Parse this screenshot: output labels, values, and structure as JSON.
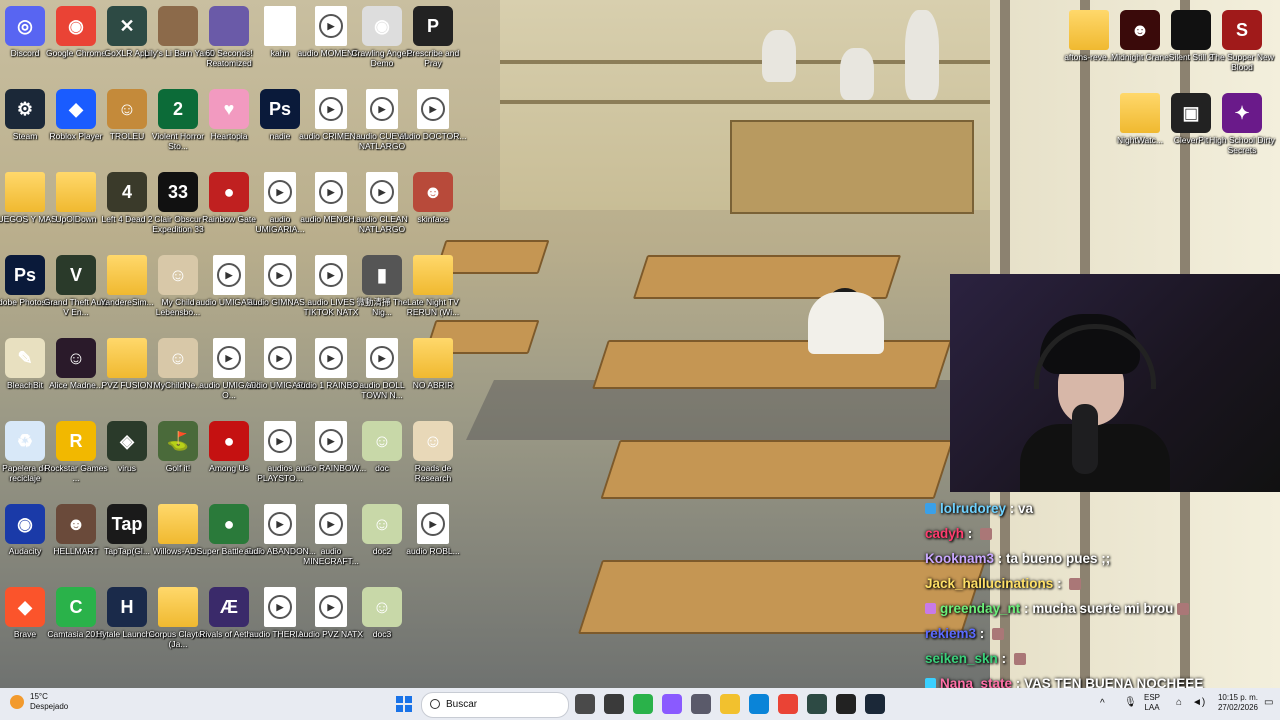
{
  "desktop_icons": [
    {
      "label": "Discord",
      "color": "#5865f2",
      "glyph": "◎",
      "x": 0,
      "y": 0
    },
    {
      "label": "Google Chrome",
      "color": "#ea4335",
      "glyph": "◉",
      "x": 1,
      "y": 0
    },
    {
      "label": "GoXLR App",
      "color": "#2d4a44",
      "glyph": "✕",
      "x": 2,
      "y": 0
    },
    {
      "label": "Lily's Li Barn Yard",
      "color": "#8c6a4a",
      "glyph": "",
      "x": 3,
      "y": 0
    },
    {
      "label": "60 Seconds! Reatomized",
      "color": "#6a5aa8",
      "glyph": "",
      "x": 4,
      "y": 0
    },
    {
      "label": "kahn",
      "color": "file",
      "glyph": "",
      "x": 5,
      "y": 0
    },
    {
      "label": "audio MOMENT...",
      "color": "audio",
      "glyph": "",
      "x": 6,
      "y": 0
    },
    {
      "label": "Crawling Angels Demo",
      "color": "#ddd",
      "glyph": "◉",
      "x": 7,
      "y": 0
    },
    {
      "label": "Prescribe and Pray",
      "color": "#222",
      "glyph": "P",
      "x": 8,
      "y": 0
    },
    {
      "label": "Steam",
      "color": "#1b2838",
      "glyph": "⚙",
      "x": 0,
      "y": 1
    },
    {
      "label": "Roblox Player",
      "color": "#1a5cff",
      "glyph": "◆",
      "x": 1,
      "y": 1
    },
    {
      "label": "TROLEU",
      "color": "#c48a3a",
      "glyph": "☺",
      "x": 2,
      "y": 1
    },
    {
      "label": "Violent Horror Sto...",
      "color": "#0c6b38",
      "glyph": "2",
      "x": 3,
      "y": 1
    },
    {
      "label": "Heartopia",
      "color": "#f29ac0",
      "glyph": "♥",
      "x": 4,
      "y": 1
    },
    {
      "label": "nadie",
      "color": "#0a1a3a",
      "glyph": "Ps",
      "x": 5,
      "y": 1
    },
    {
      "label": "audio CRIMEN...",
      "color": "audio",
      "glyph": "",
      "x": 6,
      "y": 1
    },
    {
      "label": "audio CUEVA NATLARGO",
      "color": "audio",
      "glyph": "",
      "x": 7,
      "y": 1
    },
    {
      "label": "audio DOCTOR...",
      "color": "audio",
      "glyph": "",
      "x": 8,
      "y": 1
    },
    {
      "label": "JUEGOS Y MAS",
      "color": "folder",
      "glyph": "",
      "x": 0,
      "y": 2
    },
    {
      "label": "UpOlDown",
      "color": "folder",
      "glyph": "",
      "x": 1,
      "y": 2
    },
    {
      "label": "Left 4 Dead 2",
      "color": "#3a3a2a",
      "glyph": "4",
      "x": 2,
      "y": 2
    },
    {
      "label": "Clair Obscur Expedition 33",
      "color": "#111",
      "glyph": "33",
      "x": 3,
      "y": 2
    },
    {
      "label": "Rainbow Gate",
      "color": "#c02020",
      "glyph": "●",
      "x": 4,
      "y": 2
    },
    {
      "label": "audio UMIGARIA...",
      "color": "audio",
      "glyph": "",
      "x": 5,
      "y": 2
    },
    {
      "label": "audio MENCH...",
      "color": "audio",
      "glyph": "",
      "x": 6,
      "y": 2
    },
    {
      "label": "audio CLEAN NATLARGO",
      "color": "audio",
      "glyph": "",
      "x": 7,
      "y": 2
    },
    {
      "label": "skinface",
      "color": "#b84a3a",
      "glyph": "☻",
      "x": 8,
      "y": 2
    },
    {
      "label": "Adobe Photosh...",
      "color": "#0a1a3a",
      "glyph": "Ps",
      "x": 0,
      "y": 3
    },
    {
      "label": "Grand Theft Auto V En...",
      "color": "#2a3a2a",
      "glyph": "V",
      "x": 1,
      "y": 3
    },
    {
      "label": "YandereSim...",
      "color": "folder",
      "glyph": "",
      "x": 2,
      "y": 3
    },
    {
      "label": "My Child Lebensbo...",
      "color": "#d8c8a8",
      "glyph": "☺",
      "x": 3,
      "y": 3
    },
    {
      "label": "audio UMIGARI...",
      "color": "audio",
      "glyph": "",
      "x": 4,
      "y": 3
    },
    {
      "label": "audio GIMNAS...",
      "color": "audio",
      "glyph": "",
      "x": 5,
      "y": 3
    },
    {
      "label": "audio LIVES TIKTOK NATX",
      "color": "audio",
      "glyph": "",
      "x": 6,
      "y": 3
    },
    {
      "label": "微動清掃 The Nig...",
      "color": "#555",
      "glyph": "▮",
      "x": 7,
      "y": 3
    },
    {
      "label": "Late Night TV RERUN (Wi...",
      "color": "folder",
      "glyph": "",
      "x": 8,
      "y": 3
    },
    {
      "label": "BleachBit",
      "color": "#e8e0c0",
      "glyph": "✎",
      "x": 0,
      "y": 4
    },
    {
      "label": "Alice Madne...",
      "color": "#2a1a2a",
      "glyph": "☺",
      "x": 1,
      "y": 4
    },
    {
      "label": "PVZ FUSION",
      "color": "folder",
      "glyph": "",
      "x": 2,
      "y": 4
    },
    {
      "label": "MyChildNe...",
      "color": "#d8c8a8",
      "glyph": "☺",
      "x": 3,
      "y": 4
    },
    {
      "label": "audio UMIGARI O...",
      "color": "audio",
      "glyph": "",
      "x": 4,
      "y": 4
    },
    {
      "label": "audio UMIGARI...",
      "color": "audio",
      "glyph": "",
      "x": 5,
      "y": 4
    },
    {
      "label": "audio 1 RAINBO...",
      "color": "audio",
      "glyph": "",
      "x": 6,
      "y": 4
    },
    {
      "label": "audio DOLL TOWN N...",
      "color": "audio",
      "glyph": "",
      "x": 7,
      "y": 4
    },
    {
      "label": "NO ABRIR",
      "color": "folder",
      "glyph": "",
      "x": 8,
      "y": 4
    },
    {
      "label": "Papelera de reciclaje",
      "color": "#d8e8f8",
      "glyph": "♻",
      "x": 0,
      "y": 5
    },
    {
      "label": "Rockstar Games ...",
      "color": "#f2b800",
      "glyph": "R",
      "x": 1,
      "y": 5
    },
    {
      "label": "virus",
      "color": "#2a3a2a",
      "glyph": "◈",
      "x": 2,
      "y": 5
    },
    {
      "label": "Golf it!",
      "color": "#4a6a3a",
      "glyph": "⛳",
      "x": 3,
      "y": 5
    },
    {
      "label": "Among Us",
      "color": "#c51111",
      "glyph": "●",
      "x": 4,
      "y": 5
    },
    {
      "label": "audios PLAYSTO...",
      "color": "audio",
      "glyph": "",
      "x": 5,
      "y": 5
    },
    {
      "label": "audio RAINBOW...",
      "color": "audio",
      "glyph": "",
      "x": 6,
      "y": 5
    },
    {
      "label": "doc",
      "color": "#c8d8a8",
      "glyph": "☺",
      "x": 7,
      "y": 5
    },
    {
      "label": "Roads de Research",
      "color": "#e8d8b8",
      "glyph": "☺",
      "x": 8,
      "y": 5
    },
    {
      "label": "Audacity",
      "color": "#1a3aa8",
      "glyph": "◉",
      "x": 0,
      "y": 6
    },
    {
      "label": "HELLMART",
      "color": "#6a4a3a",
      "glyph": "☻",
      "x": 1,
      "y": 6
    },
    {
      "label": "TapTap(Gl...",
      "color": "#1a1a1a",
      "glyph": "Tap",
      "x": 2,
      "y": 6
    },
    {
      "label": "Willows-AD...",
      "color": "folder",
      "glyph": "",
      "x": 3,
      "y": 6
    },
    {
      "label": "Super Battle Golf",
      "color": "#2a7a3a",
      "glyph": "●",
      "x": 4,
      "y": 6
    },
    {
      "label": "audio ABANDON...",
      "color": "audio",
      "glyph": "",
      "x": 5,
      "y": 6
    },
    {
      "label": "audio MINECRAFT...",
      "color": "audio",
      "glyph": "",
      "x": 6,
      "y": 6
    },
    {
      "label": "doc2",
      "color": "#c8d8a8",
      "glyph": "☺",
      "x": 7,
      "y": 6
    },
    {
      "label": "audio ROBL...",
      "color": "audio",
      "glyph": "",
      "x": 8,
      "y": 6
    },
    {
      "label": "Brave",
      "color": "#fb542b",
      "glyph": "◆",
      "x": 0,
      "y": 7
    },
    {
      "label": "Camtasia 2019",
      "color": "#2ab24a",
      "glyph": "C",
      "x": 1,
      "y": 7
    },
    {
      "label": "Hytale Launcher",
      "color": "#1a2a4a",
      "glyph": "H",
      "x": 2,
      "y": 7
    },
    {
      "label": "Corpus Clayton (Ja...",
      "color": "folder",
      "glyph": "",
      "x": 3,
      "y": 7
    },
    {
      "label": "Rivals of Aether",
      "color": "#3a2a6a",
      "glyph": "Æ",
      "x": 4,
      "y": 7
    },
    {
      "label": "audio THERIA...",
      "color": "audio",
      "glyph": "",
      "x": 5,
      "y": 7
    },
    {
      "label": "audio PVZ NATX",
      "color": "audio",
      "glyph": "",
      "x": 6,
      "y": 7
    },
    {
      "label": "doc3",
      "color": "#c8d8a8",
      "glyph": "☺",
      "x": 7,
      "y": 7
    }
  ],
  "right_icons": [
    {
      "label": "aftons-reve...",
      "color": "folder",
      "glyph": "",
      "x": 0,
      "y": 0
    },
    {
      "label": "Midnight Crane",
      "color": "#3a0a0a",
      "glyph": "☻",
      "x": 1,
      "y": 0
    },
    {
      "label": "Silent Still 2",
      "color": "#111",
      "glyph": "",
      "x": 2,
      "y": 0
    },
    {
      "label": "The Supper New Blood",
      "color": "#a01a1a",
      "glyph": "S",
      "x": 3,
      "y": 0
    },
    {
      "label": "NightWatc...",
      "color": "folder",
      "glyph": "",
      "x": 1,
      "y": 1
    },
    {
      "label": "CleverPit",
      "color": "#222",
      "glyph": "▣",
      "x": 2,
      "y": 1
    },
    {
      "label": "High School Dirty Secrets",
      "color": "#6a1a8a",
      "glyph": "✦",
      "x": 3,
      "y": 1
    }
  ],
  "chat": [
    {
      "user": "lolrudorey",
      "color": "#6fd2ff",
      "badge": "#3aa0e8",
      "msg": "va"
    },
    {
      "user": "cadyh",
      "color": "#ff3c6e",
      "badge": "",
      "msg": "",
      "emote": true
    },
    {
      "user": "Kooknam3",
      "color": "#c9a8ff",
      "badge": "",
      "msg": "ta bueno pues ;;"
    },
    {
      "user": "Jack_hallucinations",
      "color": "#ffe066",
      "badge": "",
      "msg": "",
      "emote": true
    },
    {
      "user": "greenday_nt",
      "color": "#6cf07a",
      "badge": "#c87ae8",
      "msg": "mucha suerte mi brou",
      "emote": true
    },
    {
      "user": "rekiem3",
      "color": "#5a6aff",
      "badge": "",
      "msg": "",
      "emote": true
    },
    {
      "user": "seiken_skn",
      "color": "#3ad07a",
      "badge": "",
      "msg": "",
      "emote": true
    },
    {
      "user": "Nana_state",
      "color": "#ff70a8",
      "badge": "#3ad0ff",
      "msg": "VAS TEN BUENA NOCHEEE"
    }
  ],
  "taskbar": {
    "weather_temp": "15°C",
    "weather_desc": "Despejado",
    "search_placeholder": "Buscar",
    "lang_top": "ESP",
    "lang_bottom": "LAA",
    "time": "10:15 p. m.",
    "date": "27/02/2026",
    "apps": [
      "file-explorer-icon",
      "clock-icon",
      "camtasia-icon",
      "copilot-icon",
      "store-icon",
      "folder-icon",
      "edge-icon",
      "chrome-icon",
      "goxlr-icon",
      "obs-icon",
      "steam-icon"
    ]
  }
}
